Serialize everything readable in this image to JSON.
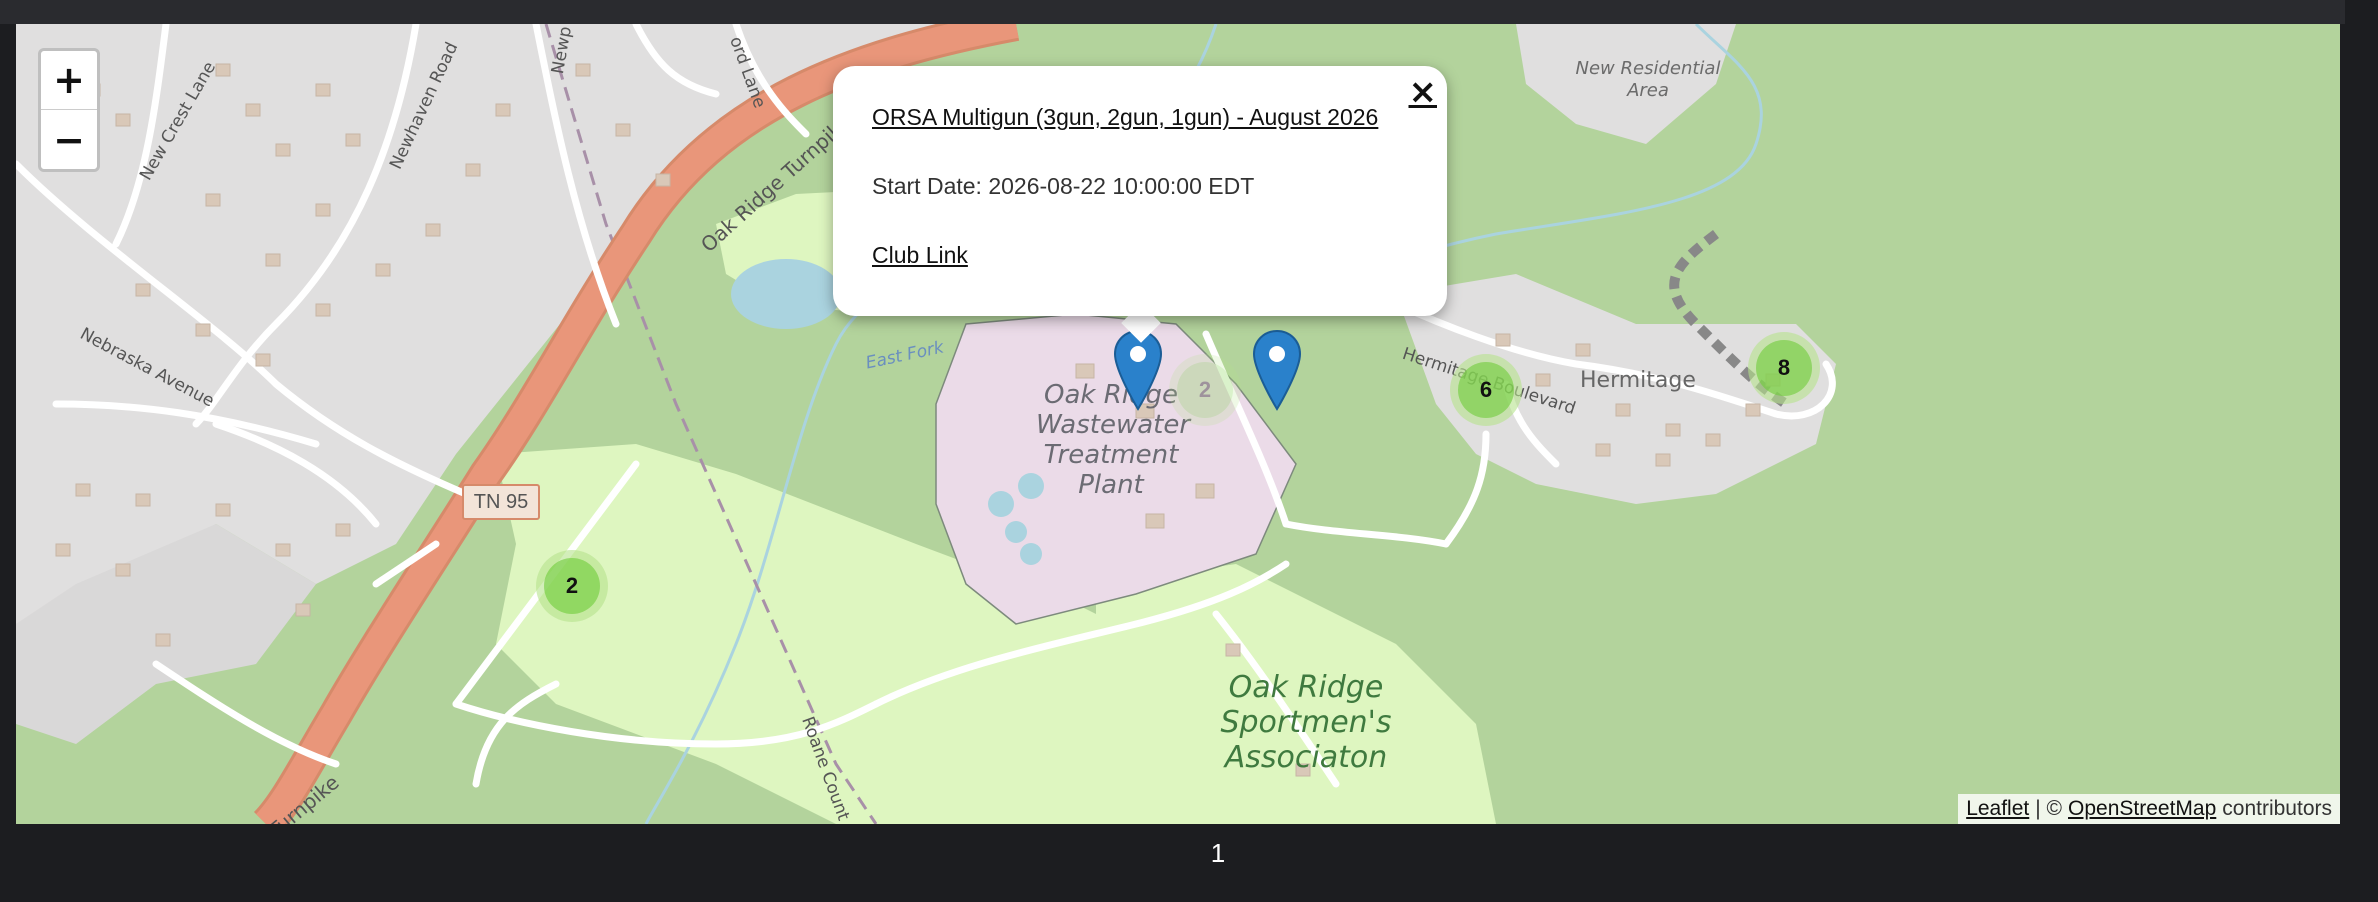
{
  "zoom": {
    "in_label": "+",
    "out_label": "−"
  },
  "street_labels": {
    "new_crest_lane": "New Crest Lane",
    "newhaven_road": "Newhaven Road",
    "newport": "Newp",
    "ford_lane": "ord Lane",
    "nebraska_avenue": "Nebraska Avenue",
    "oak_ridge_turnpike": "Oak Ridge Turnpike",
    "turnpike_bottom": "Turnpike",
    "route_shield": "TN 95",
    "east_fork": "East Fork",
    "hermitage_boulevard": "Hermitage Boulevard",
    "hermitage": "Hermitage",
    "roane_county": "Roane Count",
    "new_residential_area": "New Residential Area",
    "treatment_plant": "Oak Ridge Wastewater Treatment Plant",
    "sportsmens": "Oak Ridge Sportmen's Associaton"
  },
  "clusters": [
    {
      "count": "2",
      "tone": "normal"
    },
    {
      "count": "6",
      "tone": "normal"
    },
    {
      "count": "8",
      "tone": "normal"
    },
    {
      "count": "2",
      "tone": "faded"
    }
  ],
  "popup": {
    "close_label": "×",
    "title": "ORSA Multigun (3gun, 2gun, 1gun) - August 2026",
    "start_date": "Start Date: 2026-08-22 10:00:00 EDT",
    "club_link": "Club Link"
  },
  "attribution": {
    "leaflet": "Leaflet",
    "separator": "| ©",
    "osm": "OpenStreetMap",
    "suffix": "contributors"
  },
  "pagination": {
    "current": "1"
  },
  "colors": {
    "forest": "#b3d39c",
    "park": "#def6c0",
    "residential": "#e0dfdf",
    "industrial": "#ebdbe8",
    "highway": "#e9967a",
    "water": "#aad3df",
    "marker_blue": "#2a81cb",
    "cluster_green": "#6ecc39"
  },
  "icons": [
    "zoom-in-icon",
    "zoom-out-icon",
    "map-marker-icon",
    "close-icon"
  ]
}
